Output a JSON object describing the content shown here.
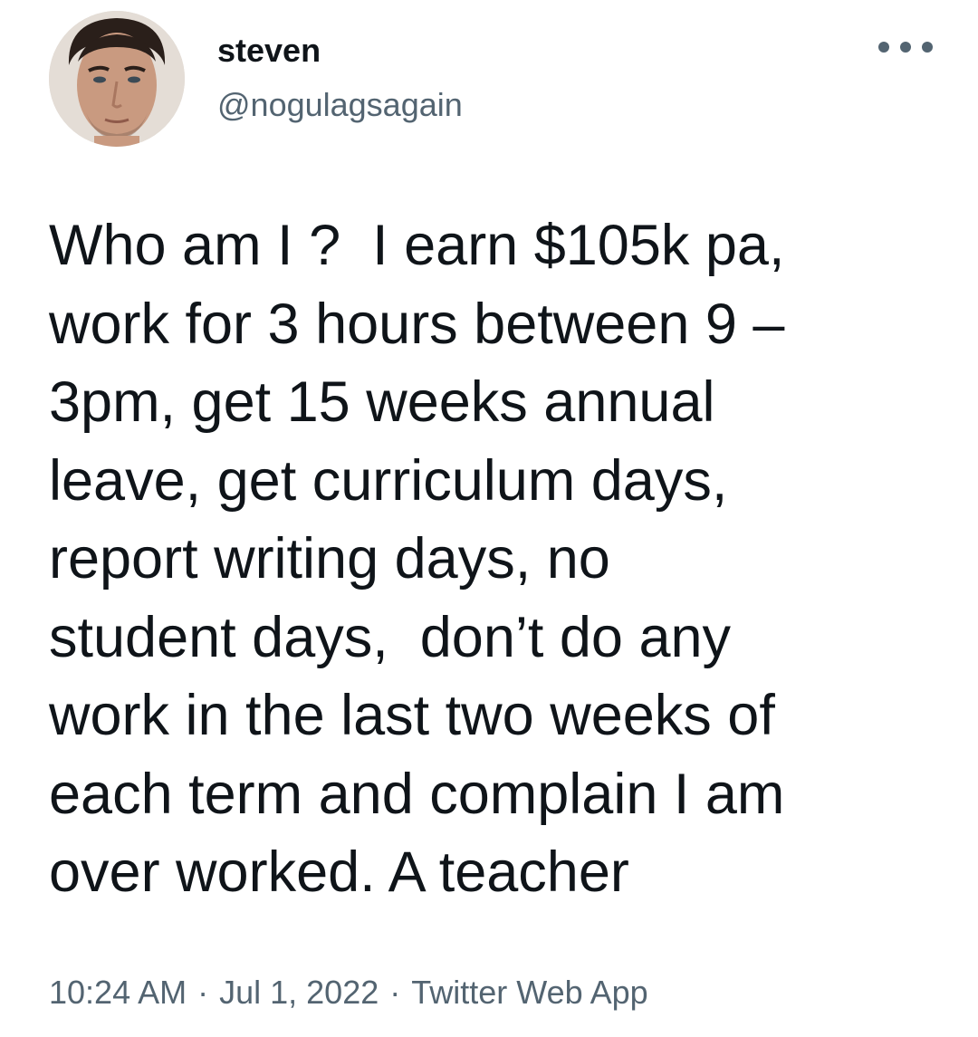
{
  "user": {
    "display_name": "steven",
    "handle": "@nogulagsagain"
  },
  "icons": {
    "more": "more-options-icon"
  },
  "tweet": {
    "lines": [
      "Who am I ?  I earn $105k pa,",
      "work for 3 hours between 9 –",
      "3pm, get 15 weeks annual",
      "leave, get curriculum days,",
      "report writing days, no",
      "student days,  don’t do any",
      "work in the last two weeks of",
      "each term and complain I am",
      "over worked. A teacher"
    ]
  },
  "meta": {
    "time": "10:24 AM",
    "separator": "·",
    "date": "Jul 1, 2022",
    "source": "Twitter Web App"
  },
  "colors": {
    "text": "#0f1419",
    "secondary": "#536471"
  }
}
